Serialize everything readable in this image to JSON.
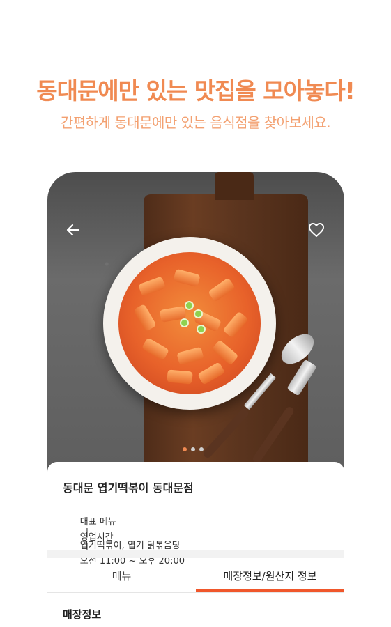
{
  "promo": {
    "headline": "동대문에만 있는 맛집을 모아놓다!",
    "subline": "간편하게 동대문에만 있는 음식점을 찾아보세요."
  },
  "hero": {
    "back_icon": "arrow-left-icon",
    "favorite_icon": "heart-outline-icon",
    "carousel_dots": 3,
    "carousel_active_index": 0
  },
  "store": {
    "name": "동대문 엽기떡볶이 동대문점",
    "menu_label": "대표 메뉴",
    "menu_value": "엽기떡볶이, 엽기 닭볶음탕",
    "hours_label": "영업시간",
    "hours_value": "오전 11:00 ~ 오후 20:00",
    "separator": "|"
  },
  "tabs": {
    "menu": "메뉴",
    "info": "매장정보/원산지 정보",
    "active": "info"
  },
  "section": {
    "title": "매장정보"
  },
  "colors": {
    "accent": "#f08a52",
    "tab_indicator": "#f0572b"
  }
}
